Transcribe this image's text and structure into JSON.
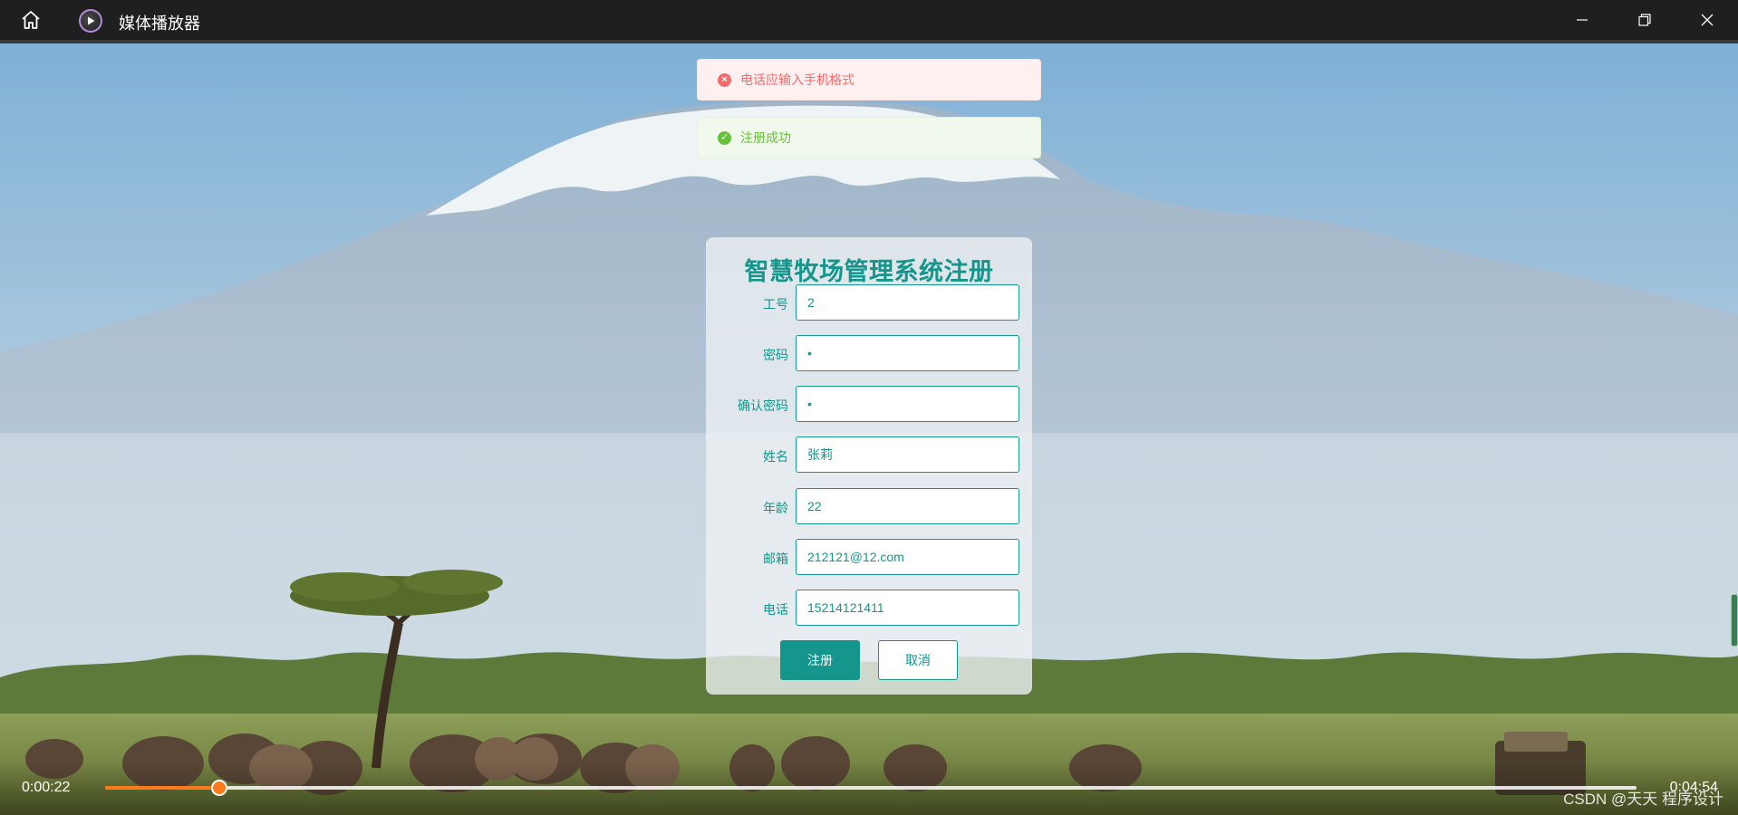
{
  "window": {
    "title": "媒体播放器"
  },
  "messages": [
    {
      "type": "error",
      "text": "电话应输入手机格式"
    },
    {
      "type": "success",
      "text": "注册成功"
    }
  ],
  "form": {
    "title": "智慧牧场管理系统注册",
    "fields": [
      {
        "label": "工号",
        "value": "2"
      },
      {
        "label": "密码",
        "value": "•"
      },
      {
        "label": "确认密码",
        "value": "•"
      },
      {
        "label": "姓名",
        "value": "张莉"
      },
      {
        "label": "年龄",
        "value": "22"
      },
      {
        "label": "邮箱",
        "value": "212121@12.com"
      },
      {
        "label": "电话",
        "value": "15214121411"
      }
    ],
    "submit_label": "注册",
    "cancel_label": "取消"
  },
  "player": {
    "current_time": "0:00:22",
    "total_time": "0:04:54",
    "progress": 0.0748
  },
  "watermark": "CSDN @天天 程序设计",
  "colors": {
    "accent": "#14968c",
    "error": "#f56c6c",
    "success": "#67c23a",
    "progress": "#ff7a1a"
  }
}
